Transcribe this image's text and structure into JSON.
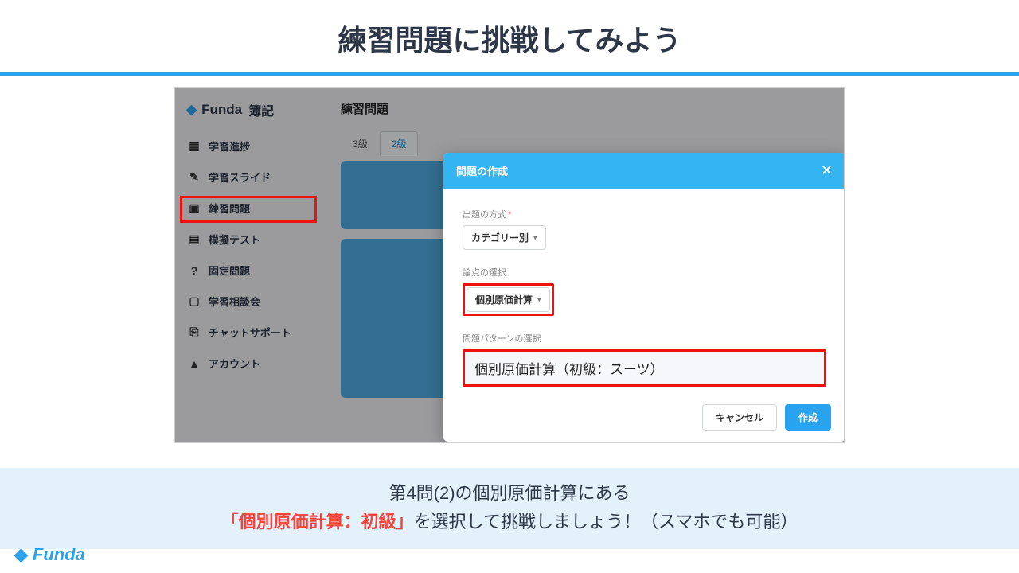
{
  "slide": {
    "title": "練習問題に挑戦してみよう"
  },
  "app": {
    "brand_name": "Funda",
    "brand_sub": "簿記",
    "sidebar": {
      "items": [
        {
          "icon": "grid",
          "label": "学習進捗"
        },
        {
          "icon": "edit",
          "label": "学習スライド"
        },
        {
          "icon": "quiz",
          "label": "練習問題"
        },
        {
          "icon": "doc",
          "label": "模擬テスト"
        },
        {
          "icon": "help",
          "label": "固定問題"
        },
        {
          "icon": "video",
          "label": "学習相談会"
        },
        {
          "icon": "chat",
          "label": "チャットサポート"
        },
        {
          "icon": "user",
          "label": "アカウント"
        }
      ]
    },
    "main": {
      "heading": "練習問題",
      "tabs": [
        {
          "label": "3級",
          "active": false
        },
        {
          "label": "2級",
          "active": true
        }
      ]
    },
    "modal": {
      "title": "問題の作成",
      "fields": {
        "method_label": "出題の方式",
        "method_value": "カテゴリー別",
        "topic_label": "論点の選択",
        "topic_value": "個別原価計算",
        "pattern_label": "問題パターンの選択",
        "pattern_value": "個別原価計算（初級：スーツ）"
      },
      "buttons": {
        "cancel": "キャンセル",
        "create": "作成"
      }
    }
  },
  "caption": {
    "line1": "第4問(2)の個別原価計算にある",
    "line2_em": "「個別原価計算：初級」",
    "line2_rest": "を選択して挑戦しましょう！（スマホでも可能）"
  },
  "footer": {
    "brand": "Funda"
  }
}
